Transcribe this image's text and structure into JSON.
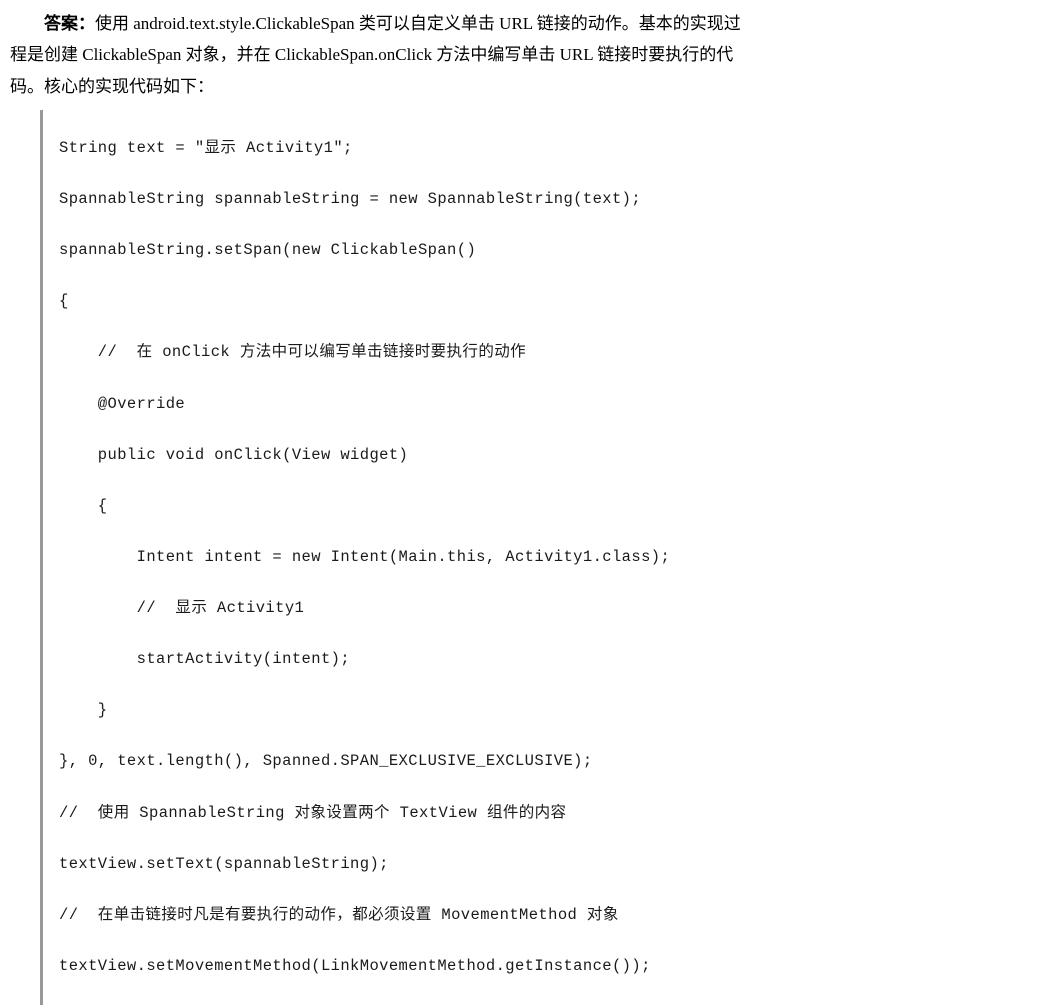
{
  "answer": {
    "label": "答案：",
    "para_line1": "使用 android.text.style.ClickableSpan 类可以自定义单击 URL 链接的动作。基本的实现过",
    "para_line2": "程是创建 ClickableSpan 对象，并在 ClickableSpan.onClick 方法中编写单击 URL 链接时要执行的代",
    "para_line3": "码。核心的实现代码如下："
  },
  "code": {
    "l01": "String text = \"显示 Activity1\";",
    "l02": "SpannableString spannableString = new SpannableString(text);",
    "l03": "spannableString.setSpan(new ClickableSpan()",
    "l04": "{",
    "l05": "    //  在 onClick 方法中可以编写单击链接时要执行的动作",
    "l06": "    @Override",
    "l07": "    public void onClick(View widget)",
    "l08": "    {",
    "l09": "        Intent intent = new Intent(Main.this, Activity1.class);",
    "l10": "        //  显示 Activity1",
    "l11": "        startActivity(intent);",
    "l12": "    }",
    "l13": "}, 0, text.length(), Spanned.SPAN_EXCLUSIVE_EXCLUSIVE);",
    "l14": "//  使用 SpannableString 对象设置两个 TextView 组件的内容",
    "l15": "textView.setText(spannableString);",
    "l16": "//  在单击链接时凡是有要执行的动作，都必须设置 MovementMethod 对象",
    "l17": "textView.setMovementMethod(LinkMovementMethod.getInstance());"
  }
}
